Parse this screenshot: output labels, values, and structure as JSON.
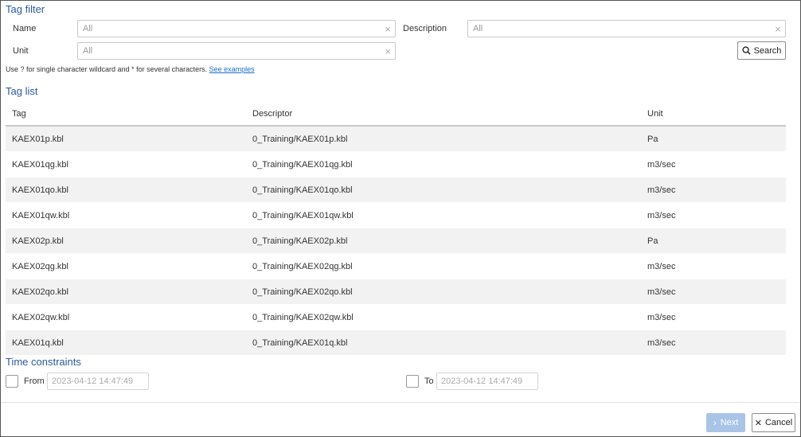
{
  "tag_filter": {
    "title": "Tag filter",
    "name_label": "Name",
    "name_value": "All",
    "description_label": "Description",
    "description_value": "All",
    "unit_label": "Unit",
    "unit_value": "All",
    "clear_symbol": "×",
    "search_label": "Search",
    "hint_text": "Use ? for single character wildcard and * for several characters.",
    "hint_link": "See examples"
  },
  "tag_list": {
    "title": "Tag list",
    "columns": [
      "Tag",
      "Descriptor",
      "Unit"
    ],
    "rows": [
      [
        "KAEX01p.kbl",
        "0_Training/KAEX01p.kbl",
        "Pa"
      ],
      [
        "KAEX01qg.kbl",
        "0_Training/KAEX01qg.kbl",
        "m3/sec"
      ],
      [
        "KAEX01qo.kbl",
        "0_Training/KAEX01qo.kbl",
        "m3/sec"
      ],
      [
        "KAEX01qw.kbl",
        "0_Training/KAEX01qw.kbl",
        "m3/sec"
      ],
      [
        "KAEX02p.kbl",
        "0_Training/KAEX02p.kbl",
        "Pa"
      ],
      [
        "KAEX02qg.kbl",
        "0_Training/KAEX02qg.kbl",
        "m3/sec"
      ],
      [
        "KAEX02qo.kbl",
        "0_Training/KAEX02qo.kbl",
        "m3/sec"
      ],
      [
        "KAEX02qw.kbl",
        "0_Training/KAEX02qw.kbl",
        "m3/sec"
      ],
      [
        "KAEX01q.kbl",
        "0_Training/KAEX01q.kbl",
        "m3/sec"
      ]
    ]
  },
  "time_constraints": {
    "title": "Time constraints",
    "from_label": "From",
    "from_value": "2023-04-12 14:47:49",
    "to_label": "To",
    "to_value": "2023-04-12 14:47:49"
  },
  "footer": {
    "next_label": "Next",
    "cancel_label": "Cancel"
  },
  "colors": {
    "accent": "#2a5aa0",
    "next_button": "#a9c4e6",
    "link": "#1a6dd0"
  }
}
